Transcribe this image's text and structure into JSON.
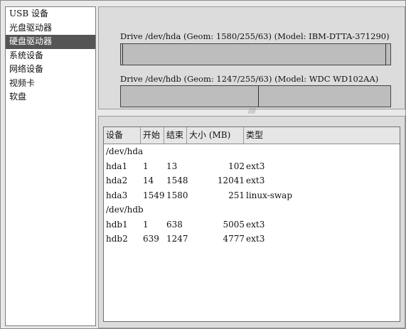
{
  "sidebar": {
    "items": [
      {
        "label": "USB 设备",
        "selected": false
      },
      {
        "label": "光盘驱动器",
        "selected": false
      },
      {
        "label": "硬盘驱动器",
        "selected": true
      },
      {
        "label": "系统设备",
        "selected": false
      },
      {
        "label": "网络设备",
        "selected": false
      },
      {
        "label": "视频卡",
        "selected": false
      },
      {
        "label": "软盘",
        "selected": false
      }
    ]
  },
  "drives": [
    {
      "label": "Drive /dev/hda (Geom: 1580/255/63) (Model: IBM-DTTA-371290)",
      "partitions": [
        {
          "name": "hda1",
          "fraction": 0.008
        },
        {
          "name": "hda2",
          "fraction": 0.976
        },
        {
          "name": "hda3",
          "fraction": 0.016
        }
      ]
    },
    {
      "label": "Drive /dev/hdb (Geom: 1247/255/63) (Model: WDC WD102AA)",
      "partitions": [
        {
          "name": "hdb1",
          "fraction": 0.512
        },
        {
          "name": "hdb2",
          "fraction": 0.488
        }
      ]
    }
  ],
  "splitter": "/////",
  "table": {
    "headers": [
      "设备",
      "开始",
      "结束",
      "大小 (MB)",
      "类型"
    ],
    "rows": [
      {
        "device": "/dev/hda",
        "start": "",
        "end": "",
        "size": "",
        "type": "",
        "group": true
      },
      {
        "device": "hda1",
        "start": "1",
        "end": "13",
        "size": "102",
        "type": "ext3"
      },
      {
        "device": "hda2",
        "start": "14",
        "end": "1548",
        "size": "12041",
        "type": "ext3"
      },
      {
        "device": "hda3",
        "start": "1549",
        "end": "1580",
        "size": "251",
        "type": "linux-swap"
      },
      {
        "device": "/dev/hdb",
        "start": "",
        "end": "",
        "size": "",
        "type": "",
        "group": true
      },
      {
        "device": "hdb1",
        "start": "1",
        "end": "638",
        "size": "5005",
        "type": "ext3"
      },
      {
        "device": "hdb2",
        "start": "639",
        "end": "1247",
        "size": "4777",
        "type": "ext3"
      }
    ]
  }
}
